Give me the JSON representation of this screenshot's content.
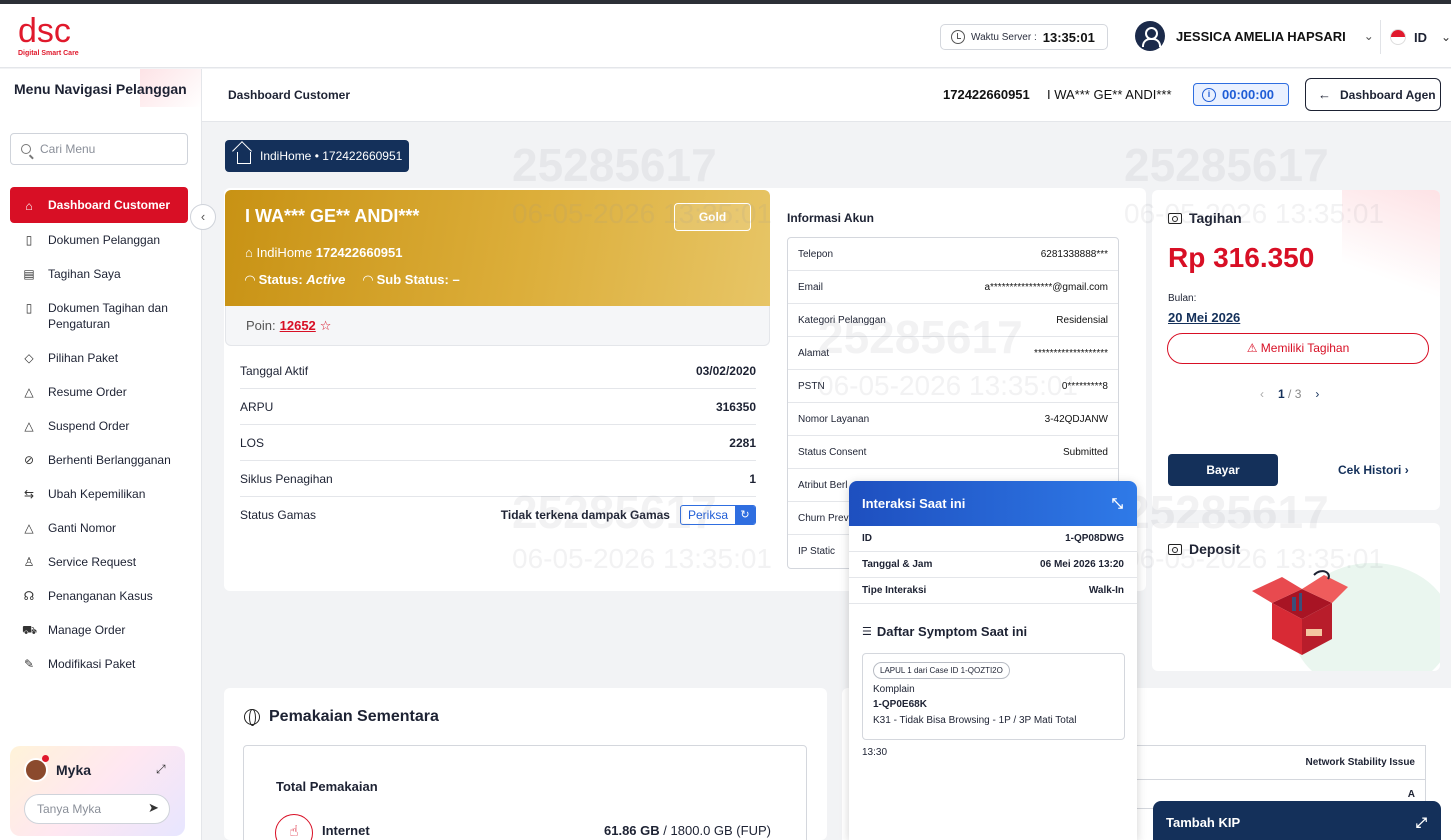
{
  "brand": {
    "logo_text": "dsc",
    "logo_sub": "Digital Smart Care",
    "colors": {
      "primary": "#d80f25",
      "navy": "#14305a",
      "gold": "#c89214",
      "blue": "#2f6ee0"
    }
  },
  "header": {
    "server_label": "Waktu Server :",
    "server_time": "13:35:01",
    "user_name": "JESSICA AMELIA HAPSARI",
    "lang": "ID"
  },
  "sidebar": {
    "title": "Menu Navigasi Pelanggan",
    "search_placeholder": "Cari Menu",
    "items": [
      {
        "label": "Dashboard Customer",
        "icon": "home-icon",
        "active": true
      },
      {
        "label": "Dokumen Pelanggan",
        "icon": "document-icon"
      },
      {
        "label": "Tagihan Saya",
        "icon": "receipt-icon"
      },
      {
        "label": "Dokumen Tagihan dan Pengaturan",
        "icon": "document-icon"
      },
      {
        "label": "Pilihan Paket",
        "icon": "layers-icon"
      },
      {
        "label": "Resume Order",
        "icon": "triangle-icon"
      },
      {
        "label": "Suspend Order",
        "icon": "triangle-icon"
      },
      {
        "label": "Berhenti Berlangganan",
        "icon": "ban-icon"
      },
      {
        "label": "Ubah Kepemilikan",
        "icon": "swap-icon"
      },
      {
        "label": "Ganti Nomor",
        "icon": "triangle-icon"
      },
      {
        "label": "Service Request",
        "icon": "user-icon"
      },
      {
        "label": "Penanganan Kasus",
        "icon": "headset-icon"
      },
      {
        "label": "Manage Order",
        "icon": "cart-icon"
      },
      {
        "label": "Modifikasi Paket",
        "icon": "edit-icon"
      }
    ],
    "myka": {
      "name": "Myka",
      "placeholder": "Tanya Myka"
    }
  },
  "subheader": {
    "breadcrumb": "Dashboard Customer",
    "number": "172422660951",
    "customer": "I WA*** GE** ANDI***",
    "timer": "00:00:00",
    "agent_button": "Dashboard Agen"
  },
  "watermark": {
    "id": "25285617",
    "date": "06-05-2026 13:35:01"
  },
  "service_tab": "IndiHome • 172422660951",
  "customer": {
    "name": "I WA*** GE** ANDI***",
    "tier": "Gold",
    "service_prefix": "IndiHome",
    "service_number": "172422660951",
    "status_label": "Status:",
    "status": "Active",
    "substatus_label": "Sub Status:",
    "substatus": "–",
    "poin_label": "Poin:",
    "poin": "12652",
    "rows": [
      {
        "label": "Tanggal Aktif",
        "value": "03/02/2020"
      },
      {
        "label": "ARPU",
        "value": "316350"
      },
      {
        "label": "LOS",
        "value": "2281"
      },
      {
        "label": "Siklus Penagihan",
        "value": "1"
      },
      {
        "label": "Status Gamas",
        "value": "Tidak terkena dampak Gamas"
      }
    ],
    "periksa_label": "Periksa"
  },
  "akun": {
    "title": "Informasi Akun",
    "rows": [
      {
        "label": "Telepon",
        "value": "6281338888***"
      },
      {
        "label": "Email",
        "value": "a****************@gmail.com"
      },
      {
        "label": "Kategori Pelanggan",
        "value": "Residensial"
      },
      {
        "label": "Alamat",
        "value": "*******************"
      },
      {
        "label": "PSTN",
        "value": "0*********8"
      },
      {
        "label": "Nomor Layanan",
        "value": "3-42QDJANW"
      },
      {
        "label": "Status Consent",
        "value": "Submitted"
      },
      {
        "label": "Atribut Berl",
        "value": ""
      },
      {
        "label": "Churn Prev",
        "value": ""
      },
      {
        "label": "IP Static",
        "value": ""
      }
    ]
  },
  "tagihan": {
    "title": "Tagihan",
    "amount": "Rp 316.350",
    "bulan_label": "Bulan:",
    "bulan": "20 Mei 2026",
    "status": "Memiliki Tagihan",
    "page": "1",
    "pages": "/ 3",
    "pay_button": "Bayar",
    "history_link": "Cek Histori"
  },
  "deposit": {
    "title": "Deposit"
  },
  "interaksi": {
    "title": "Interaksi Saat ini",
    "rows": [
      {
        "label": "ID",
        "value": "1-QP08DWG"
      },
      {
        "label": "Tanggal & Jam",
        "value": "06 Mei 2026 13:20"
      },
      {
        "label": "Tipe Interaksi",
        "value": "Walk-In"
      }
    ],
    "symptom_title": "Daftar Symptom Saat ini",
    "symptom": {
      "chip": "LAPUL 1 dari Case ID 1-QOZTI2O",
      "type": "Komplain",
      "id": "1-QP0E68K",
      "desc": "K31 - Tidak Bisa Browsing - 1P / 3P Mati Total"
    },
    "time": "13:30"
  },
  "usage": {
    "title": "Pemakaian Sementara",
    "total_label": "Total Pemakaian",
    "internet_label": "Internet",
    "used": "61.86 GB",
    "sep": "/",
    "quota": "1800.0 GB (FUP)"
  },
  "right_bottom": {
    "row1": "Network Stability Issue",
    "row2": "A"
  },
  "kip": {
    "label": "Tambah KIP"
  }
}
